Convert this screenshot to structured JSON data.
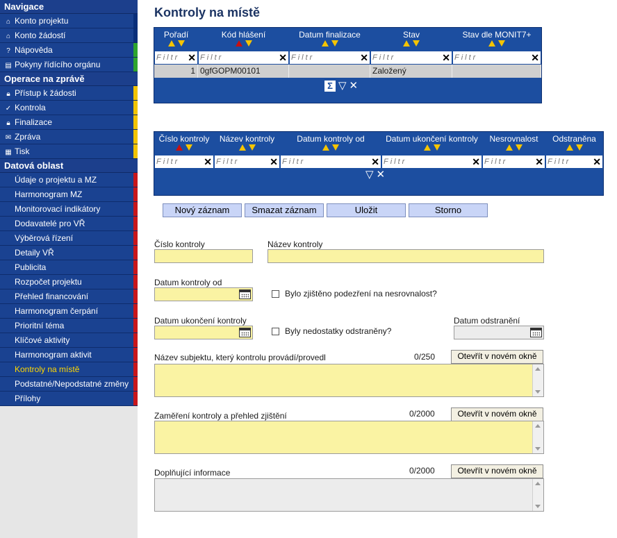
{
  "sidebar": {
    "nav_header": "Navigace",
    "nav_items": [
      {
        "icon": "house-icon",
        "glyph": "⌂",
        "label": "Konto projektu",
        "tab": "blue"
      },
      {
        "icon": "house-icon",
        "glyph": "⌂",
        "label": "Konto žádostí",
        "tab": "blue"
      },
      {
        "icon": "help-icon",
        "glyph": "?",
        "label": "Nápověda",
        "tab": "green"
      },
      {
        "icon": "book-icon",
        "glyph": "▤",
        "label": "Pokyny řídícího orgánu",
        "tab": "green"
      }
    ],
    "ops_header": "Operace na zprávě",
    "ops_items": [
      {
        "icon": "lock-icon",
        "glyph": "🔒︎",
        "label": "Přístup k žádosti",
        "tab": "yellow"
      },
      {
        "icon": "check-icon",
        "glyph": "✓",
        "label": "Kontrola",
        "tab": "yellow"
      },
      {
        "icon": "lock-icon",
        "glyph": "🔒︎",
        "label": "Finalizace",
        "tab": "yellow"
      },
      {
        "icon": "envelope-icon",
        "glyph": "✉",
        "label": "Zpráva",
        "tab": "yellow"
      },
      {
        "icon": "printer-icon",
        "glyph": "▦",
        "label": "Tisk",
        "tab": "yellow"
      }
    ],
    "data_header": "Datová oblast",
    "data_items": [
      "Údaje o projektu a MZ",
      "Harmonogram MZ",
      "Monitorovací indikátory",
      "Dodavatelé pro VŘ",
      "Výběrová řízení",
      "Detaily VŘ",
      "Publicita",
      "Rozpočet projektu",
      "Přehled financování",
      "Harmonogram čerpání",
      "Prioritní téma",
      "Klíčové aktivity",
      "Harmonogram aktivit",
      "Kontroly na místě",
      "Podstatné/Nepodstatné změny",
      "Přílohy"
    ],
    "active_item": "Kontroly na místě"
  },
  "page": {
    "title": "Kontroly na místě"
  },
  "grid1": {
    "columns": [
      "Pořadí",
      "Kód hlášení",
      "Datum finalizace",
      "Stav",
      "Stav dle MONIT7+"
    ],
    "filter_placeholder": "Filtr",
    "rows": [
      [
        "1",
        "0gfGOPM00101",
        "",
        "Založený",
        ""
      ]
    ]
  },
  "grid2": {
    "columns": [
      "Číslo kontroly",
      "Název kontroly",
      "Datum kontroly od",
      "Datum ukončení kontroly",
      "Nesrovnalost",
      "Odstraněna"
    ],
    "filter_placeholder": "Filtr",
    "rows": []
  },
  "toolbar": {
    "new_label": "Nový záznam",
    "delete_label": "Smazat záznam",
    "save_label": "Uložit",
    "cancel_label": "Storno"
  },
  "form": {
    "cislo_kontroly_label": "Číslo kontroly",
    "cislo_kontroly_value": "",
    "nazev_kontroly_label": "Název kontroly",
    "nazev_kontroly_value": "",
    "datum_od_label": "Datum kontroly od",
    "datum_od_value": "",
    "nesrovnalost_label": "Bylo zjištěno podezření na nesrovnalost?",
    "nesrovnalost_checked": false,
    "datum_ukonceni_label": "Datum ukončení kontroly",
    "datum_ukonceni_value": "",
    "odstraneny_label": "Byly nedostatky odstraněny?",
    "odstraneny_checked": false,
    "datum_odstraneni_label": "Datum odstranění",
    "datum_odstraneni_value": "",
    "subjekt_label": "Název subjektu, který kontrolu provádí/provedl",
    "subjekt_counter": "0/250",
    "zamereni_label": "Zaměření kontroly a přehled zjištění",
    "zamereni_counter": "0/2000",
    "doplnujici_label": "Doplňující informace",
    "doplnujici_counter": "0/2000",
    "open_window_label": "Otevřít v novém okně"
  },
  "colors": {
    "nav_blue": "#1a4291",
    "grid_blue": "#1c4ea0",
    "field_yellow": "#faf3a3",
    "active_text": "#ffd800",
    "title": "#1c3463"
  }
}
